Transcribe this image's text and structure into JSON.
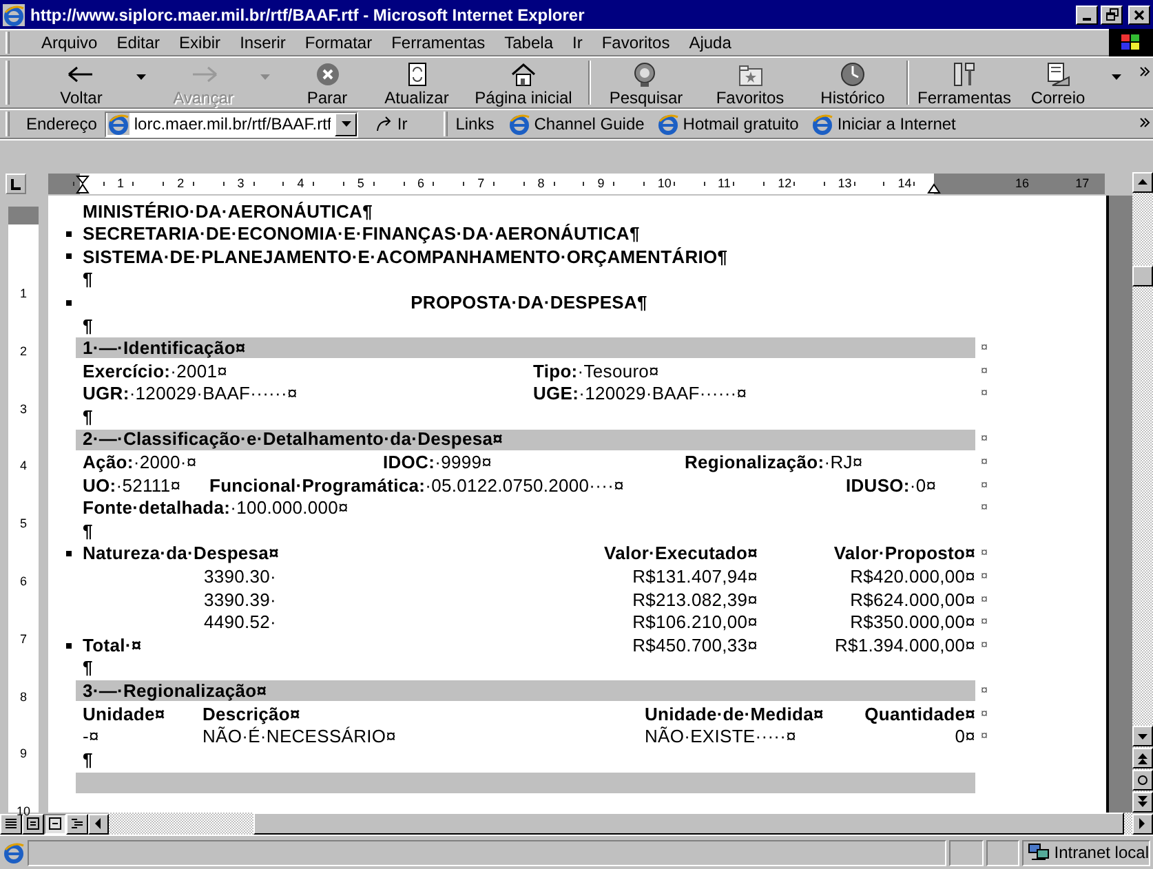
{
  "window": {
    "title": "http://www.siplorc.maer.mil.br/rtf/BAAF.rtf - Microsoft Internet Explorer"
  },
  "menu": [
    "Arquivo",
    "Editar",
    "Exibir",
    "Inserir",
    "Formatar",
    "Ferramentas",
    "Tabela",
    "Ir",
    "Favoritos",
    "Ajuda"
  ],
  "toolbar": [
    {
      "label": "Voltar",
      "kind": "back",
      "disabled": false,
      "has_menu": true,
      "separator_before": false
    },
    {
      "label": "Avançar",
      "kind": "forward",
      "disabled": true,
      "has_menu": true,
      "separator_before": false
    },
    {
      "label": "Parar",
      "kind": "stop",
      "disabled": false,
      "has_menu": false,
      "separator_before": false
    },
    {
      "label": "Atualizar",
      "kind": "refresh",
      "disabled": false,
      "has_menu": false,
      "separator_before": false
    },
    {
      "label": "Página inicial",
      "kind": "home",
      "disabled": false,
      "has_menu": false,
      "separator_before": false
    },
    {
      "label": "Pesquisar",
      "kind": "search",
      "disabled": false,
      "has_menu": false,
      "separator_before": true
    },
    {
      "label": "Favoritos",
      "kind": "favorites",
      "disabled": false,
      "has_menu": false,
      "separator_before": false
    },
    {
      "label": "Histórico",
      "kind": "history",
      "disabled": false,
      "has_menu": false,
      "separator_before": false
    },
    {
      "label": "Ferramentas",
      "kind": "tools",
      "disabled": false,
      "has_menu": false,
      "separator_before": true
    },
    {
      "label": "Correio",
      "kind": "mail",
      "disabled": false,
      "has_menu": true,
      "separator_before": false
    }
  ],
  "address": {
    "label": "Endereço",
    "value": "lorc.maer.mil.br/rtf/BAAF.rtf",
    "go": "Ir"
  },
  "links": {
    "label": "Links",
    "items": [
      "Channel Guide",
      "Hotmail gratuito",
      "Iniciar a Internet"
    ]
  },
  "ruler": {
    "marks": [
      "1",
      "2",
      "3",
      "4",
      "5",
      "6",
      "7",
      "8",
      "9",
      "10",
      "11",
      "12",
      "13",
      "14"
    ],
    "marks_after_indent": [
      "16",
      "17"
    ],
    "vertical_marks": [
      "1",
      "2",
      "3",
      "4",
      "5",
      "6",
      "7",
      "8",
      "9",
      "10"
    ]
  },
  "document": [
    {
      "kind": "line",
      "text": "MINISTÉRIO·DA·AERONÁUTICA¶",
      "keep": false
    },
    {
      "kind": "line",
      "text": "SECRETARIA·DE·ECONOMIA·E·FINANÇAS·DA·AERONÁUTICA¶",
      "keep": true
    },
    {
      "kind": "line",
      "text": "SISTEMA·DE·PLANEJAMENTO·E·ACOMPANHAMENTO·ORÇAMENTÁRIO¶",
      "keep": true
    },
    {
      "kind": "line",
      "text": "¶",
      "keep": false
    },
    {
      "kind": "title",
      "text": "PROPOSTA·DA·DESPESA¶",
      "keep": true
    },
    {
      "kind": "line",
      "text": "¶",
      "keep": false
    },
    {
      "kind": "section",
      "text": "1·—·Identificação¤",
      "end": "¤"
    },
    {
      "kind": "fields",
      "cells": [
        "**Exercício:**·2001¤",
        "**Tipo:**·Tesouro¤"
      ],
      "end": "¤"
    },
    {
      "kind": "fields",
      "cells": [
        "**UGR:**·120029·BAAF······¤",
        "**UGE:**·120029·BAAF······¤"
      ],
      "end": "¤"
    },
    {
      "kind": "line",
      "text": "¶",
      "keep": false
    },
    {
      "kind": "section",
      "text": "2·—·Classificação·e·Detalhamento·da·Despesa¤",
      "end": "¤"
    },
    {
      "kind": "fields",
      "cells": [
        "**Ação:**·2000·¤",
        "**IDOC:**·9999¤",
        "**Regionalização:**·RJ¤"
      ],
      "end": "¤"
    },
    {
      "kind": "fields",
      "cells": [
        "**UO:**·52111¤",
        "**Funcional·Programática:**·05.0122.0750.2000····¤",
        "**IDUSO:**·0¤"
      ],
      "end": "¤"
    },
    {
      "kind": "fields",
      "cells": [
        "**Fonte·detalhada:**·100.000.000¤"
      ],
      "end": "¤"
    },
    {
      "kind": "line",
      "text": "¶",
      "keep": false
    },
    {
      "kind": "table",
      "keep": true,
      "cells": [
        {
          "text": "Natureza·da·Despesa¤",
          "bold": true
        },
        {
          "text": "Valor·Executado¤",
          "bold": true
        },
        {
          "text": "Valor·Proposto¤",
          "bold": true
        }
      ],
      "end": "¤"
    },
    {
      "kind": "table",
      "keep": false,
      "cells": [
        {
          "text": "3390.30·",
          "bold": false
        },
        {
          "text": "R$131.407,94¤",
          "bold": false
        },
        {
          "text": "R$420.000,00¤",
          "bold": false
        }
      ],
      "end": "¤"
    },
    {
      "kind": "table",
      "keep": false,
      "cells": [
        {
          "text": "3390.39·",
          "bold": false
        },
        {
          "text": "R$213.082,39¤",
          "bold": false
        },
        {
          "text": "R$624.000,00¤",
          "bold": false
        }
      ],
      "end": "¤"
    },
    {
      "kind": "table",
      "keep": false,
      "cells": [
        {
          "text": "4490.52·",
          "bold": false
        },
        {
          "text": "R$106.210,00¤",
          "bold": false
        },
        {
          "text": "R$350.000,00¤",
          "bold": false
        }
      ],
      "end": "¤"
    },
    {
      "kind": "table",
      "keep": true,
      "cells": [
        {
          "text": "Total·¤",
          "bold": true
        },
        {
          "text": "R$450.700,33¤",
          "bold": false
        },
        {
          "text": "R$1.394.000,00¤",
          "bold": false
        }
      ],
      "end": "¤"
    },
    {
      "kind": "line",
      "text": "¶",
      "keep": false
    },
    {
      "kind": "section",
      "text": "3·—·Regionalização¤",
      "end": "¤"
    },
    {
      "kind": "table",
      "keep": false,
      "cells": [
        {
          "text": "Unidade¤",
          "bold": true
        },
        {
          "text": "Descrição¤",
          "bold": true
        },
        {
          "text": "Unidade·de·Medida¤",
          "bold": true
        },
        {
          "text": "Quantidade¤",
          "bold": true
        }
      ],
      "end": "¤"
    },
    {
      "kind": "table",
      "keep": false,
      "cells": [
        {
          "text": "-¤",
          "bold": false
        },
        {
          "text": "NÃO·É·NECESSÁRIO¤",
          "bold": false
        },
        {
          "text": "NÃO·EXISTE·····¤",
          "bold": false
        },
        {
          "text": "0¤",
          "bold": false
        }
      ],
      "end": "¤"
    },
    {
      "kind": "line",
      "text": "¶",
      "keep": false
    },
    {
      "kind": "section"
    }
  ],
  "status_bar": {
    "zone": "Intranet local"
  }
}
